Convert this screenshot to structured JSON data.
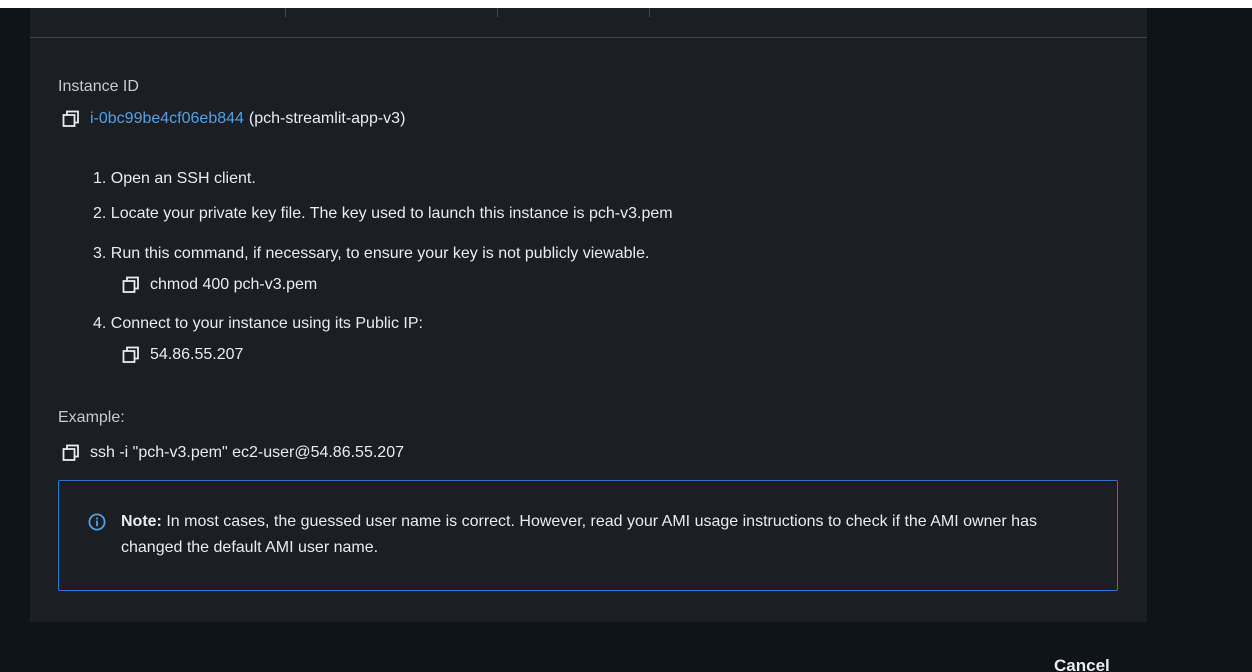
{
  "instance": {
    "label": "Instance ID",
    "id": "i-0bc99be4cf06eb844",
    "name": "(pch-streamlit-app-v3)"
  },
  "steps": [
    {
      "text": "1. Open an SSH client."
    },
    {
      "text": "2. Locate your private key file. The key used to launch this instance is pch-v3.pem"
    },
    {
      "text": "3. Run this command, if necessary, to ensure your key is not publicly viewable.",
      "code": "chmod 400 pch-v3.pem"
    },
    {
      "text": "4. Connect to your instance using its Public IP:",
      "code": "54.86.55.207"
    }
  ],
  "example": {
    "label": "Example:",
    "command": "ssh -i \"pch-v3.pem\" ec2-user@54.86.55.207"
  },
  "note": {
    "bold": "Note:",
    "text": " In most cases, the guessed user name is correct. However, read your AMI usage instructions to check if the AMI owner has changed the default AMI user name."
  },
  "footer": {
    "cancel_label": "Cancel"
  },
  "colors": {
    "link": "#539fe5",
    "note_border": "#2c74c8",
    "panel_bg": "#1b1f24"
  },
  "icons": [
    "copy-icon",
    "info-icon"
  ]
}
